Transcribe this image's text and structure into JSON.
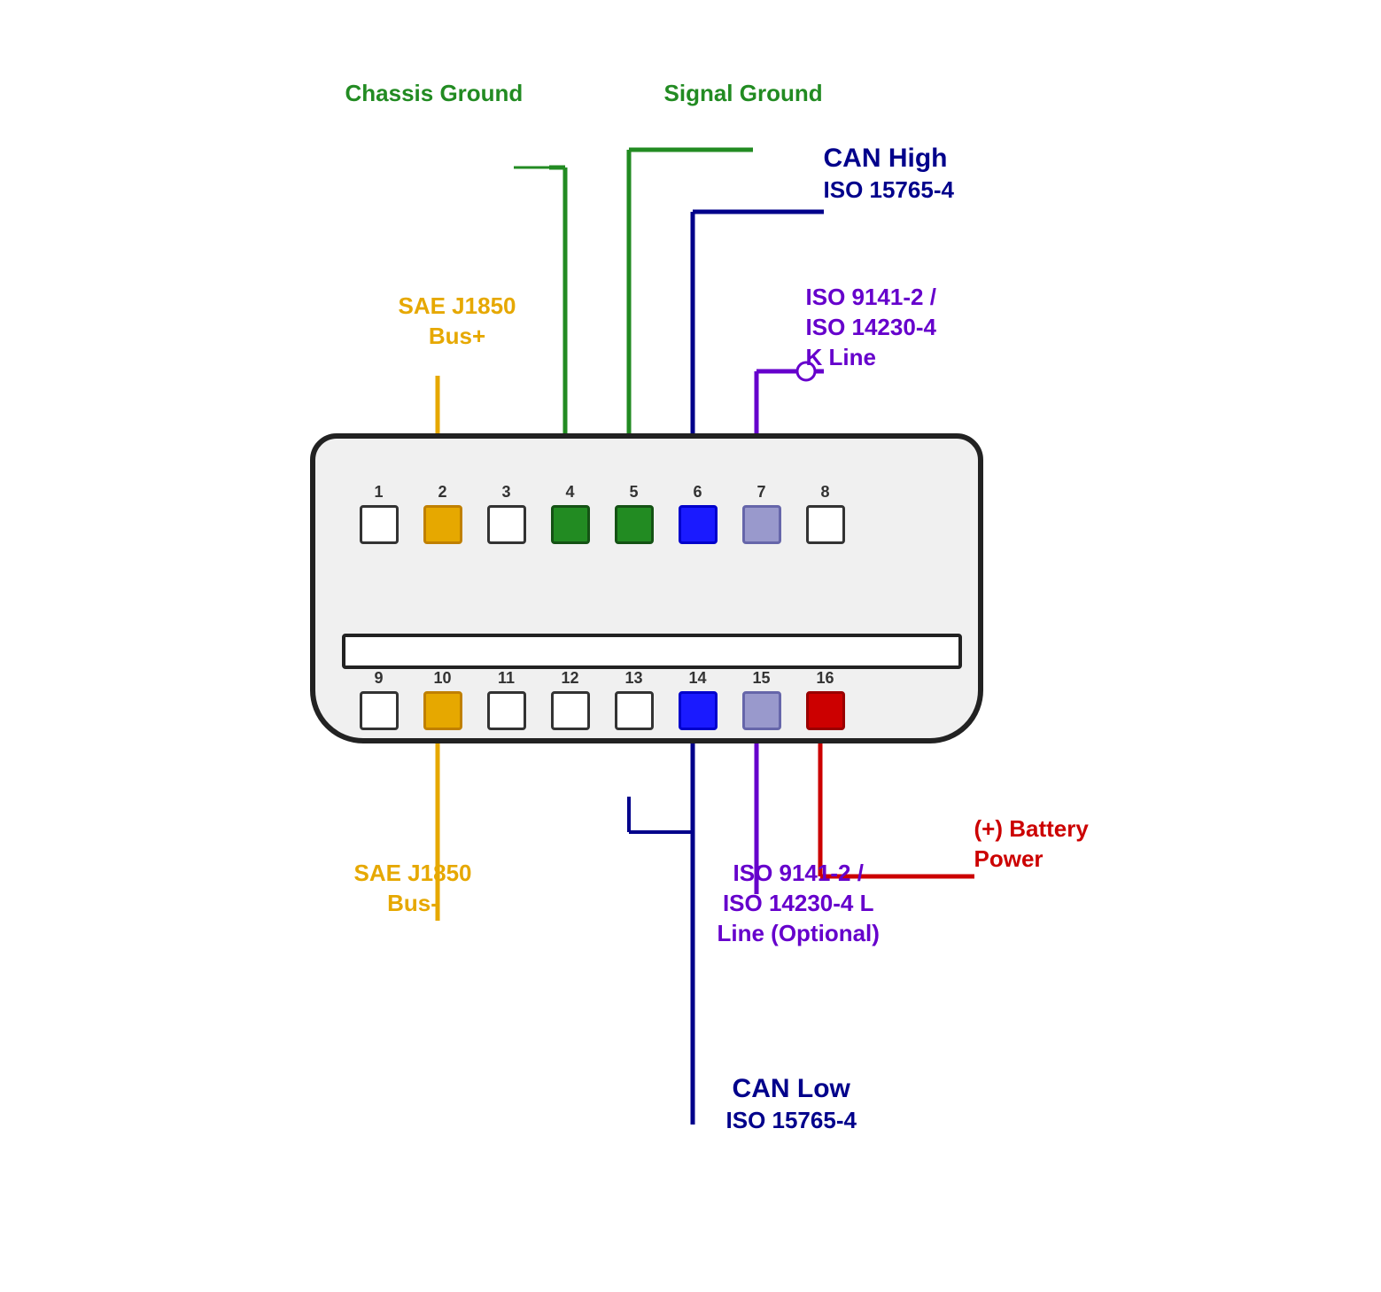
{
  "labels": {
    "chassis_ground": "Chassis Ground",
    "signal_ground": "Signal Ground",
    "can_high_line1": "CAN High",
    "can_high_line2": "ISO 15765-4",
    "iso_k_line1": "ISO 9141-2 /",
    "iso_k_line2": "ISO 14230-4",
    "iso_k_line3": "K Line",
    "sae_j1850_busplus_line1": "SAE J1850",
    "sae_j1850_busplus_line2": "Bus+",
    "sae_j1850_busminus_line1": "SAE J1850",
    "sae_j1850_busminus_line2": "Bus-",
    "battery_power_line1": "(+) Battery",
    "battery_power_line2": "Power",
    "iso_l_line1": "ISO 9141-2 /",
    "iso_l_line2": "ISO 14230-4 L",
    "iso_l_line3": "Line (Optional)",
    "can_low_line1": "CAN Low",
    "can_low_line2": "ISO 15765-4"
  },
  "pins": {
    "top_row": [
      {
        "number": "1",
        "color": "white"
      },
      {
        "number": "2",
        "color": "gold"
      },
      {
        "number": "3",
        "color": "white"
      },
      {
        "number": "4",
        "color": "green"
      },
      {
        "number": "5",
        "color": "green"
      },
      {
        "number": "6",
        "color": "blue"
      },
      {
        "number": "7",
        "color": "lavender"
      },
      {
        "number": "8",
        "color": "white"
      }
    ],
    "bottom_row": [
      {
        "number": "9",
        "color": "white"
      },
      {
        "number": "10",
        "color": "gold"
      },
      {
        "number": "11",
        "color": "white"
      },
      {
        "number": "12",
        "color": "white"
      },
      {
        "number": "13",
        "color": "white"
      },
      {
        "number": "14",
        "color": "blue"
      },
      {
        "number": "15",
        "color": "lavender"
      },
      {
        "number": "16",
        "color": "red"
      }
    ]
  },
  "colors": {
    "green": "#228B22",
    "blue_dark": "#00008B",
    "purple": "#6600cc",
    "gold": "#e6a800",
    "red": "#cc0000"
  }
}
